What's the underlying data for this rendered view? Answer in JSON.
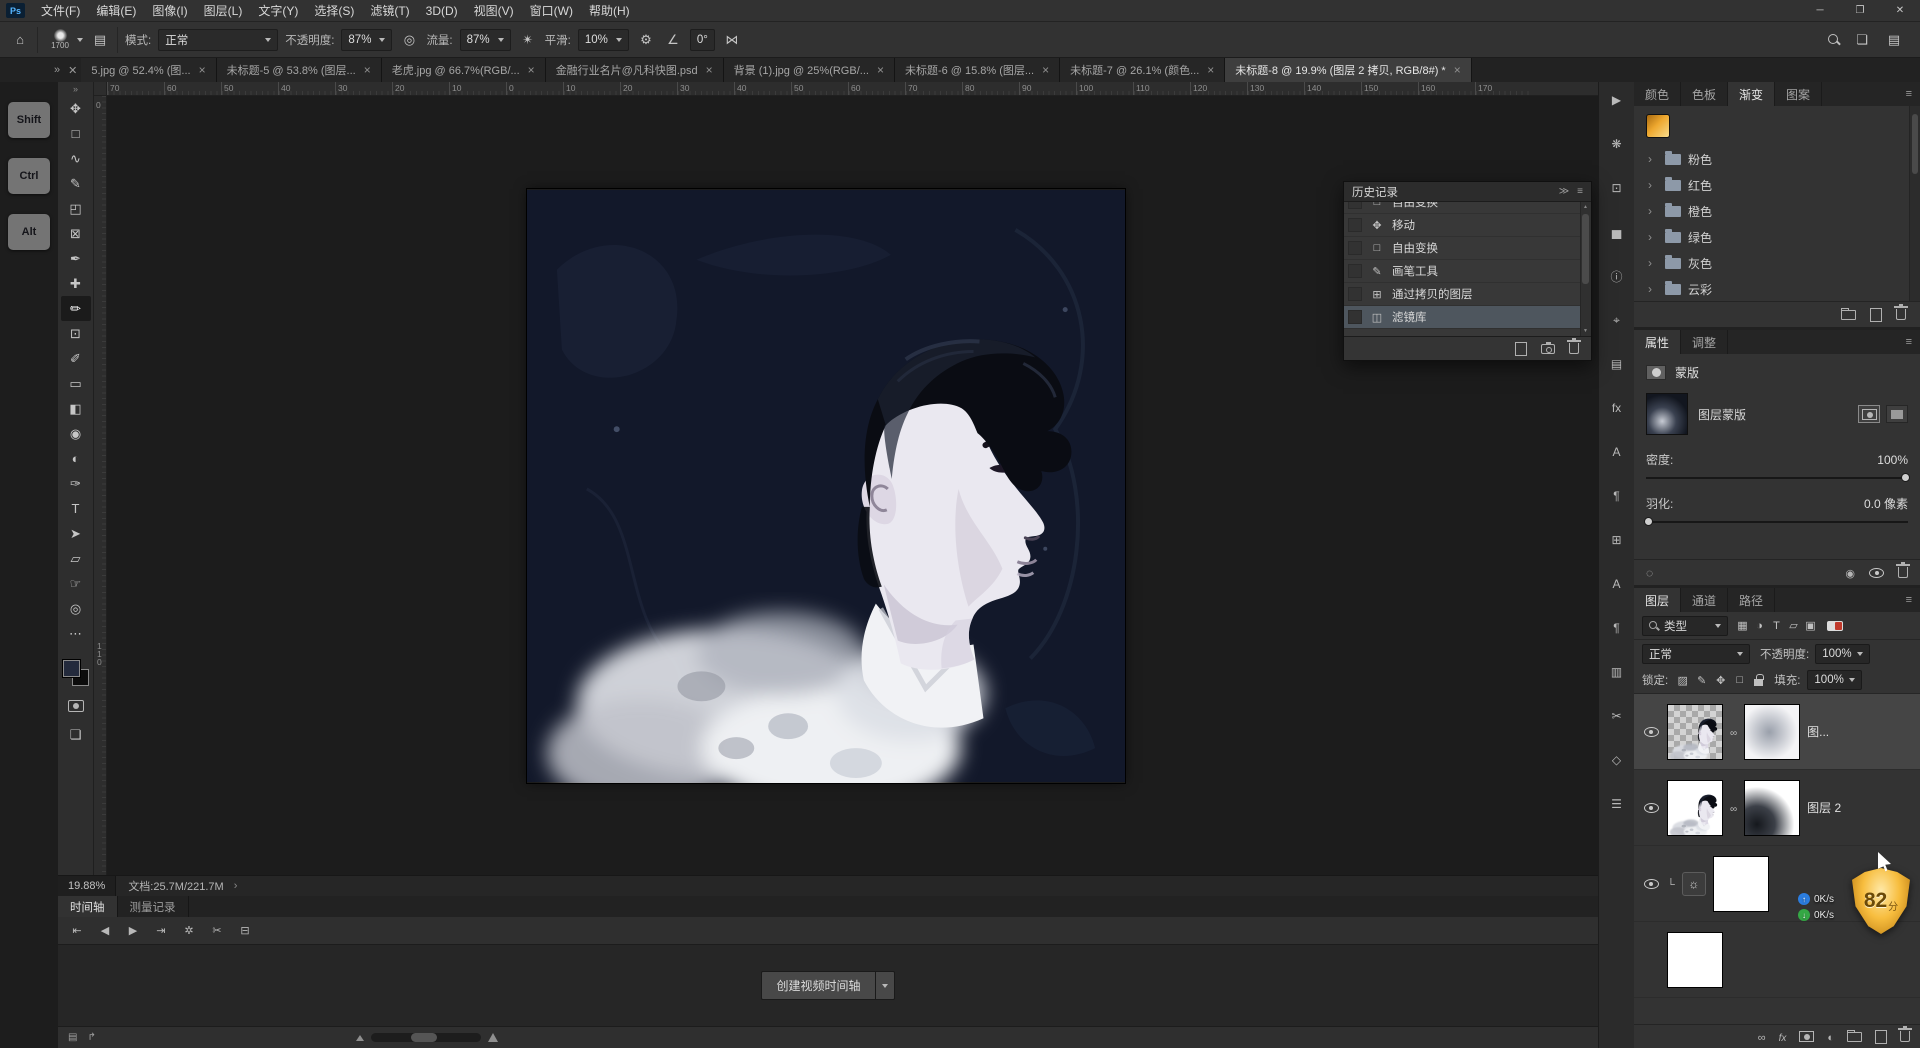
{
  "colors": {
    "ps_logo_accent": "#55b5ff",
    "ui_bar": "#323232",
    "canvas_pasteboard": "#1c1c1c",
    "history_selected": "#4e565e",
    "foreground_swatch": "#232a3c",
    "background_swatch": "#0c0c0c",
    "gradient_chip_start": "#a8690f",
    "gradient_chip_end": "#f8dc8c",
    "net_up": "#2b7de0",
    "net_down": "#35a845",
    "shield_gold": "#f7bd3e"
  },
  "menu": {
    "logo": "Ps",
    "items": [
      "文件(F)",
      "编辑(E)",
      "图像(I)",
      "图层(L)",
      "文字(Y)",
      "选择(S)",
      "滤镜(T)",
      "3D(D)",
      "视图(V)",
      "窗口(W)",
      "帮助(H)"
    ],
    "window_buttons": [
      {
        "name": "minimize-button",
        "glyph": "─"
      },
      {
        "name": "maximize-button",
        "glyph": "❐"
      },
      {
        "name": "close-button",
        "glyph": "✕"
      }
    ]
  },
  "options": {
    "home_icon": "⌂",
    "brush_size": "1700",
    "panel_toggle_icon": "▤",
    "mode_label": "模式:",
    "mode_value": "正常",
    "opacity_label": "不透明度:",
    "opacity_value": "87%",
    "pressure_icon": "◎",
    "flow_label": "流量:",
    "flow_value": "87%",
    "airbrush_icon": "✴",
    "smooth_label": "平滑:",
    "smooth_value": "10%",
    "gear_icon": "⚙",
    "angle_icon": "∠",
    "angle_value": "0°",
    "symmetry_icon": "⋈",
    "workspace_icon": "❏"
  },
  "tab_overflow_icon": "»",
  "tab_overflow_close_icon": "✕",
  "doc_tabs": [
    {
      "label": "5.jpg @ 52.4% (图...",
      "state": ""
    },
    {
      "label": "未标题-5 @ 53.8% (图层...",
      "state": ""
    },
    {
      "label": "老虎.jpg @ 66.7%(RGB/...",
      "state": ""
    },
    {
      "label": "金融行业名片@凡科快图.psd",
      "state": ""
    },
    {
      "label": "背景 (1).jpg @ 25%(RGB/...",
      "state": ""
    },
    {
      "label": "未标题-6 @ 15.8% (图层...",
      "state": ""
    },
    {
      "label": "未标题-7 @ 26.1% (颜色...",
      "state": ""
    },
    {
      "label": "未标题-8 @ 19.9% (图层 2 拷贝, RGB/8#) *",
      "state": "active"
    }
  ],
  "shortcuts": [
    "Shift",
    "Ctrl",
    "Alt"
  ],
  "toolbar": {
    "collapse_icon": "»",
    "screen_mode_icon": "❏",
    "tools": [
      {
        "name": "move-tool",
        "glyph": "✥",
        "state": ""
      },
      {
        "name": "marquee-tool",
        "glyph": "□",
        "state": ""
      },
      {
        "name": "lasso-tool",
        "glyph": "∿",
        "state": ""
      },
      {
        "name": "quick-selection-tool",
        "glyph": "✎",
        "state": ""
      },
      {
        "name": "crop-tool",
        "glyph": "◰",
        "state": ""
      },
      {
        "name": "frame-tool",
        "glyph": "⊠",
        "state": ""
      },
      {
        "name": "eyedropper-tool",
        "glyph": "✒",
        "state": ""
      },
      {
        "name": "healing-brush-tool",
        "glyph": "✚",
        "state": ""
      },
      {
        "name": "brush-tool",
        "glyph": "✏",
        "state": "active"
      },
      {
        "name": "clone-stamp-tool",
        "glyph": "⊡",
        "state": ""
      },
      {
        "name": "history-brush-tool",
        "glyph": "✐",
        "state": ""
      },
      {
        "name": "eraser-tool",
        "glyph": "▭",
        "state": ""
      },
      {
        "name": "gradient-tool",
        "glyph": "◧",
        "state": ""
      },
      {
        "name": "blur-tool",
        "glyph": "◉",
        "state": ""
      },
      {
        "name": "dodge-tool",
        "glyph": "◐",
        "state": ""
      },
      {
        "name": "pen-tool",
        "glyph": "✑",
        "state": ""
      },
      {
        "name": "type-tool",
        "glyph": "T",
        "state": ""
      },
      {
        "name": "path-selection-tool",
        "glyph": "➤",
        "state": ""
      },
      {
        "name": "shape-tool",
        "glyph": "▱",
        "state": ""
      },
      {
        "name": "hand-tool",
        "glyph": "☞",
        "state": ""
      },
      {
        "name": "zoom-tool",
        "glyph": "◎",
        "state": ""
      },
      {
        "name": "edit-toolbar-button",
        "glyph": "⋯",
        "state": ""
      }
    ]
  },
  "rulers": {
    "h": [
      "70",
      "60",
      "50",
      "40",
      "30",
      "20",
      "10",
      "0",
      "10",
      "20",
      "30",
      "40",
      "50",
      "60",
      "70",
      "80",
      "90",
      "100",
      "110",
      "120",
      "130",
      "140",
      "150",
      "160",
      "170"
    ],
    "v_top": "0",
    "v_bottom": "110"
  },
  "status": {
    "zoom": "19.88%",
    "doc_info": "文档:25.7M/221.7M",
    "chevron": "›"
  },
  "history": {
    "title": "历史记录",
    "collapse_icon": "≫",
    "menu_icon": "≡",
    "rows": [
      {
        "icon": "□",
        "label": "自由变换",
        "state": "clipped"
      },
      {
        "icon": "✥",
        "label": "移动",
        "state": ""
      },
      {
        "icon": "□",
        "label": "自由变换",
        "state": ""
      },
      {
        "icon": "✎",
        "label": "画笔工具",
        "state": ""
      },
      {
        "icon": "⊞",
        "label": "通过拷贝的图层",
        "state": ""
      },
      {
        "icon": "◫",
        "label": "滤镜库",
        "state": "selected"
      }
    ]
  },
  "dock_icons": [
    {
      "name": "actions-panel-icon",
      "glyph": "▶"
    },
    {
      "name": "brush-settings-panel-icon",
      "glyph": "❋"
    },
    {
      "name": "clone-source-panel-icon",
      "glyph": "⊡"
    },
    {
      "name": "histogram-panel-icon",
      "glyph": "▅"
    },
    {
      "name": "info-panel-icon",
      "glyph": "ⓘ"
    },
    {
      "name": "navigator-panel-icon",
      "glyph": "⌖"
    },
    {
      "name": "layer-comps-panel-icon",
      "glyph": "▤"
    },
    {
      "name": "styles-panel-icon",
      "glyph": "fx"
    },
    {
      "name": "character-panel-icon",
      "glyph": "A"
    },
    {
      "name": "paragraph-panel-icon",
      "glyph": "¶"
    },
    {
      "name": "glyphs-panel-icon",
      "glyph": "⊞"
    },
    {
      "name": "character-styles-panel-icon",
      "glyph": "A"
    },
    {
      "name": "paragraph-styles-panel-icon",
      "glyph": "¶"
    },
    {
      "name": "libraries-panel-icon",
      "glyph": "▥"
    },
    {
      "name": "tool-presets-panel-icon",
      "glyph": "✂"
    },
    {
      "name": "3d-panel-icon",
      "glyph": "◇"
    },
    {
      "name": "properties-panel-icon",
      "glyph": "☰"
    }
  ],
  "gradients": {
    "tabs": [
      {
        "label": "颜色",
        "state": ""
      },
      {
        "label": "色板",
        "state": ""
      },
      {
        "label": "渐变",
        "state": "active"
      },
      {
        "label": "图案",
        "state": ""
      }
    ],
    "groups": [
      {
        "label": "粉色"
      },
      {
        "label": "红色"
      },
      {
        "label": "橙色"
      },
      {
        "label": "绿色"
      },
      {
        "label": "灰色"
      },
      {
        "label": "云彩"
      }
    ]
  },
  "properties": {
    "tabs": [
      {
        "label": "属性",
        "state": "active"
      },
      {
        "label": "调整",
        "state": ""
      }
    ],
    "mask_title": "蒙版",
    "mask_layer_label": "图层蒙版",
    "density_label": "密度:",
    "density_value": "100%",
    "feather_label": "羽化:",
    "feather_value": "0.0 像素"
  },
  "layers": {
    "tabs": [
      {
        "label": "图层",
        "state": "active"
      },
      {
        "label": "通道",
        "state": ""
      },
      {
        "label": "路径",
        "state": ""
      }
    ],
    "search_label": "类型",
    "filter_icons": [
      {
        "name": "filter-pixel-layers-icon",
        "glyph": "▦"
      },
      {
        "name": "filter-adjustment-layers-icon",
        "glyph": "◑"
      },
      {
        "name": "filter-type-layers-icon",
        "glyph": "T"
      },
      {
        "name": "filter-shape-layers-icon",
        "glyph": "▱"
      },
      {
        "name": "filter-smart-object-icon",
        "glyph": "▣"
      }
    ],
    "blend_mode": "正常",
    "opacity_label": "不透明度:",
    "opacity_value": "100%",
    "lock_label": "锁定:",
    "lock_icons": [
      {
        "name": "lock-transparency-icon",
        "glyph": "▨"
      },
      {
        "name": "lock-paint-icon",
        "glyph": "✎"
      },
      {
        "name": "lock-position-icon",
        "glyph": "✥"
      },
      {
        "name": "lock-artboard-icon",
        "glyph": "□"
      }
    ],
    "fill_label": "填充:",
    "fill_value": "100%",
    "rows": [
      {
        "label": "图...",
        "kind": "art-checker",
        "state": "selected",
        "eye": "visible"
      },
      {
        "label": "图层 2",
        "kind": "art-white",
        "state": "",
        "eye": "visible"
      },
      {
        "label": "",
        "kind": "adjustment",
        "state": "",
        "eye": "visible"
      },
      {
        "label": "",
        "kind": "white",
        "state": "",
        "eye": "hidden"
      }
    ]
  },
  "timeline": {
    "tabs": [
      {
        "label": "时间轴",
        "state": "active"
      },
      {
        "label": "测量记录",
        "state": ""
      }
    ],
    "transport": [
      {
        "name": "first-frame-button",
        "glyph": "⇤"
      },
      {
        "name": "prev-frame-button",
        "glyph": "◀"
      },
      {
        "name": "play-button",
        "glyph": "▶"
      },
      {
        "name": "next-frame-button",
        "glyph": "⇥"
      },
      {
        "name": "audio-settings-button",
        "glyph": "✲"
      },
      {
        "name": "split-clip-button",
        "glyph": "✂"
      },
      {
        "name": "transition-button",
        "glyph": "⊟"
      }
    ],
    "create_button": "创建视频时间轴",
    "frames_icon": "▤",
    "flatten_icon": "↱"
  },
  "overlay": {
    "up_value": "0K/s",
    "down_value": "0K/s",
    "score": "82",
    "score_unit": "分"
  }
}
